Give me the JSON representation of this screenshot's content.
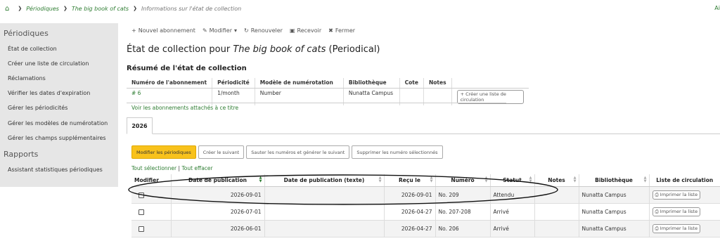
{
  "breadcrumb": {
    "items": [
      "Périodiques",
      "The big book of cats"
    ],
    "current": "Informations sur l'état de collection",
    "right_text": "Ai"
  },
  "sidebar": {
    "section1_title": "Périodiques",
    "items": [
      "État de collection",
      "Créer une liste de circulation",
      "Réclamations",
      "Vérifier les dates d'expiration",
      "Gérer les périodicités",
      "Gérer les modèles de numérotation",
      "Gérer les champs supplémentaires"
    ],
    "section2_title": "Rapports",
    "section2_items": [
      "Assistant statistiques périodiques"
    ]
  },
  "toolbar": {
    "new_subscription": "Nouvel abonnement",
    "edit": "Modifier",
    "renew": "Renouveler",
    "receive": "Recevoir",
    "close": "Fermer"
  },
  "page": {
    "title_prefix": "État de collection pour ",
    "title_book": "The big book of cats",
    "title_suffix": " (Periodical)",
    "summary_heading": "Résumé de l'état de collection"
  },
  "summary_table": {
    "headers": [
      "Numéro de l'abonnement",
      "Périodicité",
      "Modèle de numérotation",
      "Bibliothèque",
      "Cote",
      "Notes",
      ""
    ],
    "row": [
      "# 6",
      "1/month",
      "Number",
      "Nunatta Campus",
      "",
      "",
      ""
    ],
    "create_route_button": "Créer une liste de circulation",
    "attached_link": "Voir les abonnements attachés à ce titre"
  },
  "tabs": [
    "2026"
  ],
  "actions": {
    "edit_serials": "Modifier les périodiques",
    "generate_next": "Créer le suivant",
    "skip_generate": "Sauter les numéros et générer le suivant",
    "delete_selected": "Supprimer les numéro sélectionnés"
  },
  "select_links": {
    "select_all": "Tout sélectionner",
    "separator": "|",
    "clear_all": "Tout effacer"
  },
  "issues_table": {
    "headers": [
      "Modifier",
      "Date de publication",
      "Date de publication (texte)",
      "Reçu le",
      "Numéro",
      "Statut",
      "Notes",
      "Bibliothèque",
      "Liste de circulation"
    ],
    "print_label": "Imprimer la liste",
    "rows": [
      {
        "pubdate": "2026-09-01",
        "pubdate_text": "",
        "received": "2026-09-01",
        "number": "No. 209",
        "status": "Attendu",
        "notes": "",
        "library": "Nunatta Campus"
      },
      {
        "pubdate": "2026-07-01",
        "pubdate_text": "",
        "received": "2026-04-27",
        "number": "No. 207-208",
        "status": "Arrivé",
        "notes": "",
        "library": "Nunatta Campus"
      },
      {
        "pubdate": "2026-06-01",
        "pubdate_text": "",
        "received": "2026-04-27",
        "number": "No. 206",
        "status": "Arrivé",
        "notes": "",
        "library": "Nunatta Campus"
      }
    ]
  },
  "colors": {
    "link_green": "#2e7d32",
    "primary_button": "#f8c21c",
    "sidebar_bg": "#e6e6e6"
  },
  "icons": [
    "home-icon",
    "plus-icon",
    "pencil-icon",
    "refresh-icon",
    "inbox-icon",
    "close-circle-icon",
    "printer-icon",
    "sort-icon"
  ]
}
